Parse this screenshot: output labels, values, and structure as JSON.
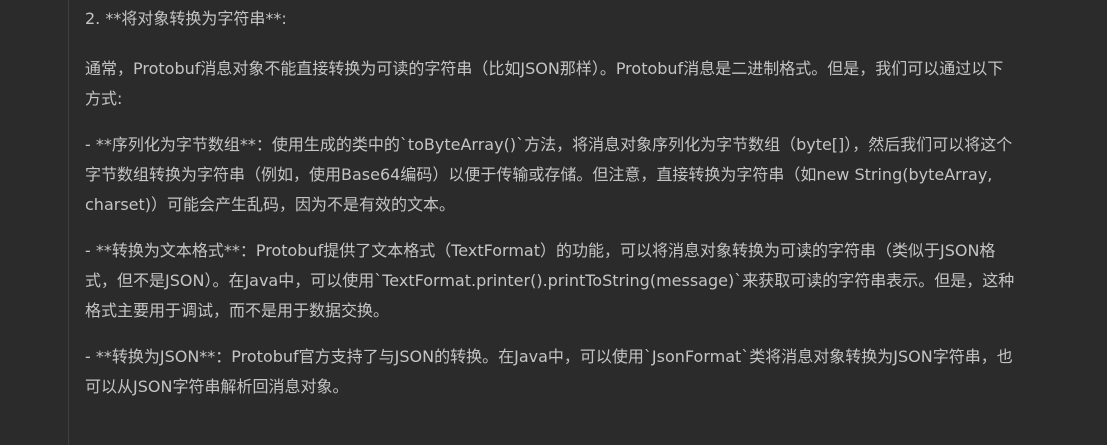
{
  "message": {
    "heading": "2. **将对象转换为字符串**:",
    "intro": "通常，Protobuf消息对象不能直接转换为可读的字符串（比如JSON那样）。Protobuf消息是二进制格式。但是，我们可以通过以下方式:",
    "items": [
      {
        "text": "- **序列化为字节数组**：使用生成的类中的`toByteArray()`方法，将消息对象序列化为字节数组（byte[]），然后我们可以将这个字节数组转换为字符串（例如，使用Base64编码）以便于传输或存储。但注意，直接转换为字符串（如new String(byteArray, charset)）可能会产生乱码，因为不是有效的文本。"
      },
      {
        "text": "- **转换为文本格式**：Protobuf提供了文本格式（TextFormat）的功能，可以将消息对象转换为可读的字符串（类似于JSON格式，但不是JSON）。在Java中，可以使用`TextFormat.printer().printToString(message)`来获取可读的字符串表示。但是，这种格式主要用于调试，而不是用于数据交换。"
      },
      {
        "text": "- **转换为JSON**：Protobuf官方支持了与JSON的转换。在Java中，可以使用`JsonFormat`类将消息对象转换为JSON字符串，也可以从JSON字符串解析回消息对象。"
      }
    ]
  },
  "colors": {
    "background": "#2b2b2b",
    "text": "#c4c4c4",
    "divider": "#3f3f3f"
  }
}
